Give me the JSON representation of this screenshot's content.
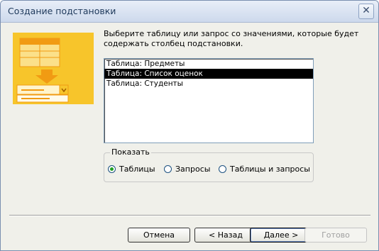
{
  "window": {
    "title": "Создание подстановки",
    "close_glyph": "✕"
  },
  "instruction": "Выберите таблицу или запрос со значениями, которые будет содержать столбец подстановки.",
  "list": {
    "items": [
      "Таблица: Предметы",
      "Таблица: Список оценок",
      "Таблица: Студенты"
    ],
    "selected_index": 1
  },
  "show_group": {
    "label": "Показать",
    "options": [
      "Таблицы",
      "Запросы",
      "Таблицы и запросы"
    ],
    "selected_index": 0
  },
  "buttons": {
    "cancel": "Отмена",
    "back": "< Назад",
    "next": "Далее >",
    "finish": "Готово"
  },
  "colors": {
    "wizard_yellow": "#f7c52b",
    "wizard_orange": "#f19b13",
    "selection": "#000000",
    "radio_check": "#21a121"
  }
}
